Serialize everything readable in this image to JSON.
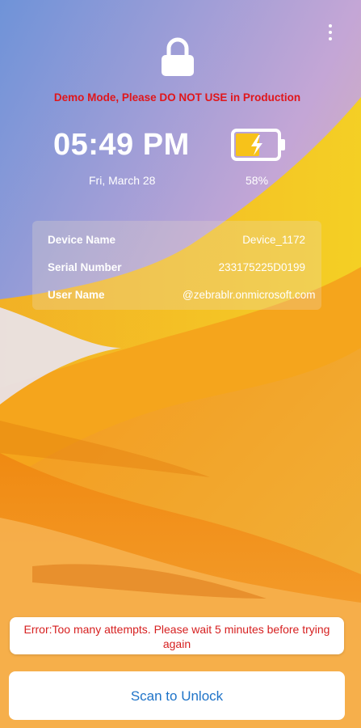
{
  "header": {
    "demo_notice": "Demo Mode, Please DO NOT USE in Production"
  },
  "status": {
    "time": "05:49 PM",
    "date": "Fri, March 28",
    "battery_percent": "58%",
    "battery_level": 0.58,
    "battery_charging": true
  },
  "device_info": {
    "rows": [
      {
        "label": "Device Name",
        "value": "Device_1172"
      },
      {
        "label": "Serial Number",
        "value": "233175225D0199"
      },
      {
        "label": "User Name",
        "value": "@zebrablr.onmicrosoft.com"
      }
    ]
  },
  "error": {
    "message": "Error:Too many attempts. Please wait 5 minutes before trying again"
  },
  "actions": {
    "scan_label": "Scan to Unlock"
  },
  "colors": {
    "demo_notice": "#e0161b",
    "error": "#d61f1f",
    "scan_button_text": "#1e73c8",
    "battery_fill": "#f7c21a"
  },
  "icons": {
    "menu": "more-vertical-icon",
    "lock": "lock-icon",
    "battery": "battery-charging-icon"
  }
}
